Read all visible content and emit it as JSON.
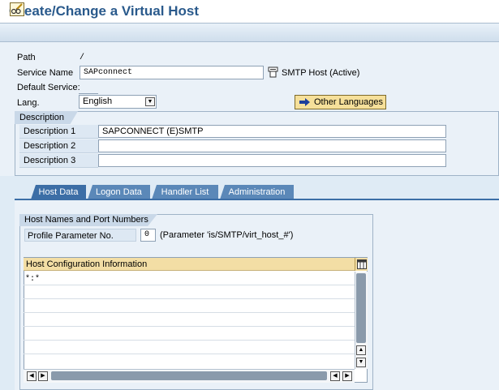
{
  "title": "Create/Change a Virtual Host",
  "toolbar": {
    "change_icon": "pencil-glasses-icon"
  },
  "fields": {
    "path_label": "Path",
    "path_value": "/",
    "service_name_label": "Service Name",
    "service_name_value": "SAPconnect",
    "smtp_host_label": "SMTP Host (Active)",
    "default_service_label": "Default Service:",
    "lang_label": "Lang.",
    "lang_value": "English",
    "other_languages_label": "Other Languages"
  },
  "description": {
    "group_label": "Description",
    "rows": [
      {
        "label": "Description 1",
        "value": "SAPCONNECT (E)SMTP"
      },
      {
        "label": "Description 2",
        "value": ""
      },
      {
        "label": "Description 3",
        "value": ""
      }
    ]
  },
  "tabs": [
    {
      "label": "Host Data",
      "active": true
    },
    {
      "label": "Logon Data",
      "active": false
    },
    {
      "label": "Handler List",
      "active": false
    },
    {
      "label": "Administration",
      "active": false
    }
  ],
  "host_data": {
    "group_label": "Host Names and Port Numbers",
    "profile_param_label": "Profile Parameter No.",
    "profile_param_value": "0",
    "profile_param_hint": "(Parameter 'is/SMTP/virt_host_#')",
    "table": {
      "header": "Host Configuration Information",
      "rows": [
        "*:*",
        "",
        "",
        "",
        "",
        "",
        ""
      ]
    }
  },
  "colors": {
    "title_blue": "#2a5a8c",
    "tab_active": "#3c6ea6",
    "table_header": "#f3dea5",
    "other_lang_button": "#f6e09a"
  }
}
